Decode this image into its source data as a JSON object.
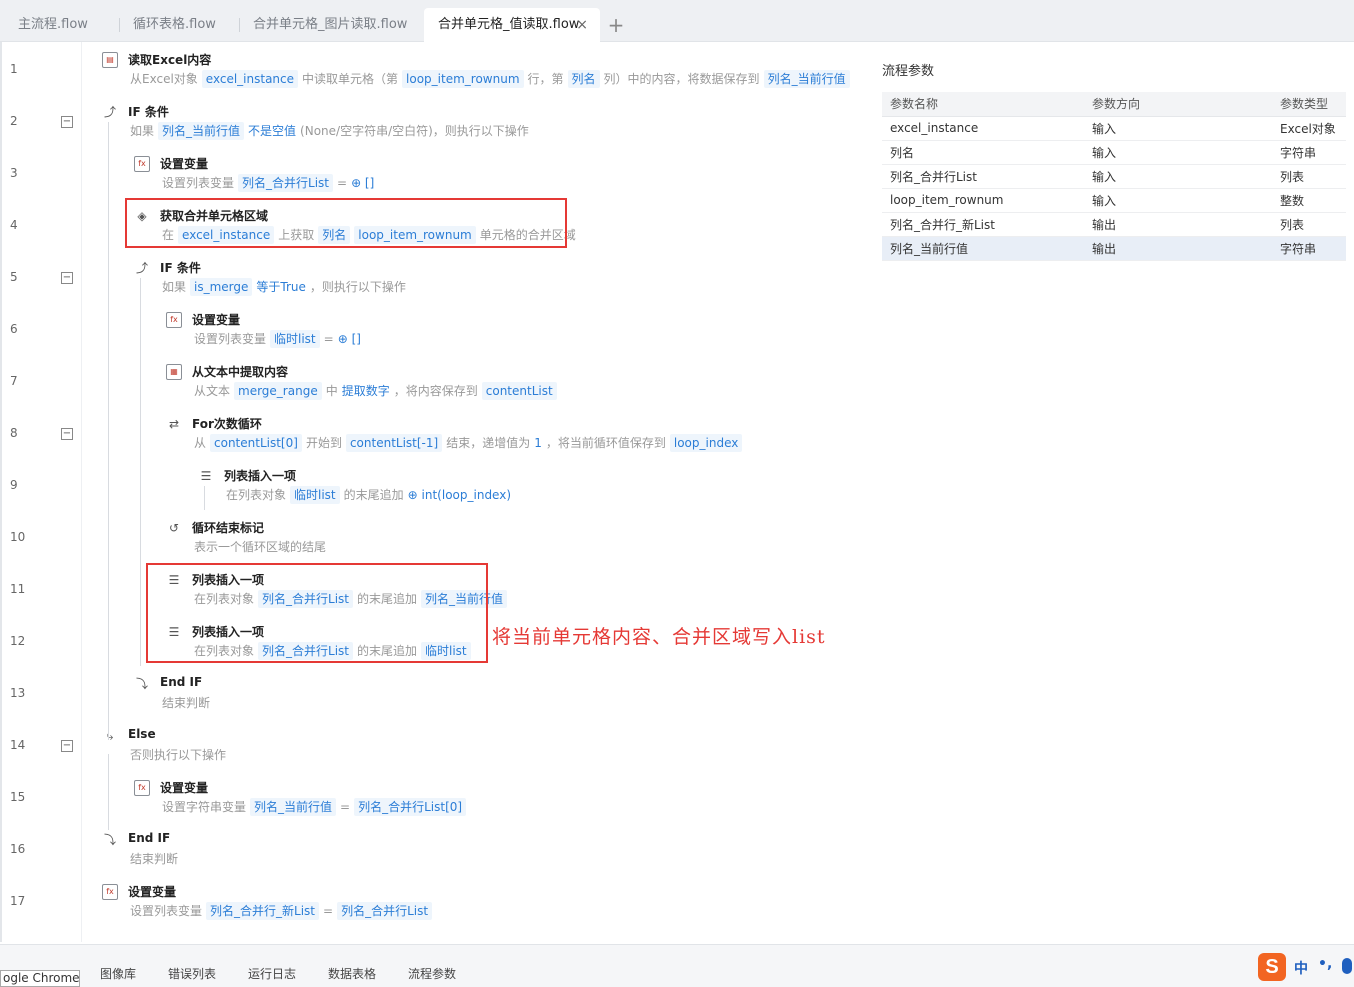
{
  "tabs": [
    {
      "label": "主流程.flow"
    },
    {
      "label": "循环表格.flow"
    },
    {
      "label": "合并单元格_图片读取.flow"
    },
    {
      "label": "合并单元格_值读取.flow"
    }
  ],
  "tabs_close": "×",
  "tabs_add": "+",
  "lines": [
    "1",
    "2",
    "3",
    "4",
    "5",
    "6",
    "7",
    "8",
    "9",
    "10",
    "11",
    "12",
    "13",
    "14",
    "15",
    "16",
    "17"
  ],
  "fold_symbol": "−",
  "steps": [
    {
      "icon": "excel-read-icon",
      "title": "读取Excel内容",
      "desc": [
        {
          "t": "从Excel对象"
        },
        {
          "t": "excel_instance",
          "k": "tk"
        },
        {
          "t": "中读取单元格（第"
        },
        {
          "t": "loop_item_rownum",
          "k": "tk"
        },
        {
          "t": "行，第"
        },
        {
          "t": "列名",
          "k": "tk"
        },
        {
          "t": "列）中的内容，将数据保存到"
        },
        {
          "t": "列名_当前行值",
          "k": "tk"
        }
      ]
    },
    {
      "icon": "if-icon",
      "title": "IF 条件",
      "desc": [
        {
          "t": "如果"
        },
        {
          "t": "列名_当前行值",
          "k": "tk"
        },
        {
          "t": "不是空值",
          "k": "bl"
        },
        {
          "t": "(None/空字符串/空白符)，则执行以下操作"
        }
      ]
    },
    {
      "icon": "set-variable-icon",
      "title": "设置变量",
      "desc": [
        {
          "t": "设置列表变量"
        },
        {
          "t": "列名_合并行List",
          "k": "tk"
        },
        {
          "t": "="
        },
        {
          "t": "⊕ []",
          "k": "bl"
        }
      ]
    },
    {
      "icon": "layers-icon",
      "title": "获取合并单元格区域",
      "desc": [
        {
          "t": "在"
        },
        {
          "t": "excel_instance",
          "k": "tk"
        },
        {
          "t": "上获取"
        },
        {
          "t": "列名",
          "k": "tk"
        },
        {
          "t": "loop_item_rownum",
          "k": "tk"
        },
        {
          "t": "单元格的合并区域"
        }
      ]
    },
    {
      "icon": "if-icon",
      "title": "IF 条件",
      "desc": [
        {
          "t": "如果"
        },
        {
          "t": "is_merge",
          "k": "tk"
        },
        {
          "t": "等于True",
          "k": "bl"
        },
        {
          "t": "，则执行以下操作"
        }
      ]
    },
    {
      "icon": "set-variable-icon",
      "title": "设置变量",
      "desc": [
        {
          "t": "设置列表变量"
        },
        {
          "t": "临时list",
          "k": "tk"
        },
        {
          "t": "="
        },
        {
          "t": "⊕ []",
          "k": "bl"
        }
      ]
    },
    {
      "icon": "text-extract-icon",
      "title": "从文本中提取内容",
      "desc": [
        {
          "t": "从文本"
        },
        {
          "t": "merge_range",
          "k": "tk"
        },
        {
          "t": "中"
        },
        {
          "t": "提取数字",
          "k": "bl"
        },
        {
          "t": "，将内容保存到"
        },
        {
          "t": "contentList",
          "k": "tk"
        }
      ]
    },
    {
      "icon": "loop-icon",
      "title": "For次数循环",
      "desc": [
        {
          "t": "从"
        },
        {
          "t": "contentList[0]",
          "k": "tk"
        },
        {
          "t": "开始到"
        },
        {
          "t": "contentList[-1]",
          "k": "tk"
        },
        {
          "t": "结束，递增值为"
        },
        {
          "t": "1",
          "k": "bl"
        },
        {
          "t": "，将当前循环值保存到"
        },
        {
          "t": "loop_index",
          "k": "tk"
        }
      ]
    },
    {
      "icon": "list-insert-icon",
      "title": "列表插入一项",
      "desc": [
        {
          "t": "在列表对象"
        },
        {
          "t": "临时list",
          "k": "tk"
        },
        {
          "t": "的末尾追加"
        },
        {
          "t": "⊕ int(loop_index)",
          "k": "bl"
        }
      ]
    },
    {
      "icon": "loop-end-icon",
      "title": "循环结束标记",
      "desc": [
        {
          "t": "表示一个循环区域的结尾"
        }
      ]
    },
    {
      "icon": "list-insert-icon",
      "title": "列表插入一项",
      "desc": [
        {
          "t": "在列表对象"
        },
        {
          "t": "列名_合并行List",
          "k": "tk"
        },
        {
          "t": "的末尾追加"
        },
        {
          "t": "列名_当前行值",
          "k": "tk"
        }
      ]
    },
    {
      "icon": "list-insert-icon",
      "title": "列表插入一项",
      "desc": [
        {
          "t": "在列表对象"
        },
        {
          "t": "列名_合并行List",
          "k": "tk"
        },
        {
          "t": "的末尾追加"
        },
        {
          "t": "临时list",
          "k": "tk"
        }
      ]
    },
    {
      "icon": "end-if-icon",
      "title": "End IF",
      "desc": [
        {
          "t": "结束判断"
        }
      ]
    },
    {
      "icon": "else-icon",
      "title": "Else",
      "desc": [
        {
          "t": "否则执行以下操作"
        }
      ]
    },
    {
      "icon": "set-variable-icon",
      "title": "设置变量",
      "desc": [
        {
          "t": "设置字符串变量"
        },
        {
          "t": "列名_当前行值",
          "k": "tk"
        },
        {
          "t": "="
        },
        {
          "t": "列名_合并行List[0]",
          "k": "tk"
        }
      ]
    },
    {
      "icon": "end-if-icon",
      "title": "End IF",
      "desc": [
        {
          "t": "结束判断"
        }
      ]
    },
    {
      "icon": "set-variable-icon",
      "title": "设置变量",
      "desc": [
        {
          "t": "设置列表变量"
        },
        {
          "t": "列名_合并行_新List",
          "k": "tk"
        },
        {
          "t": "="
        },
        {
          "t": "列名_合并行List",
          "k": "tk"
        }
      ]
    }
  ],
  "annotation": "将当前单元格内容、合并区域写入list",
  "params": {
    "title": "流程参数",
    "headers": [
      "参数名称",
      "参数方向",
      "参数类型"
    ],
    "rows": [
      [
        "excel_instance",
        "输入",
        "Excel对象"
      ],
      [
        "列名",
        "输入",
        "字符串"
      ],
      [
        "列名_合并行List",
        "输入",
        "列表"
      ],
      [
        "loop_item_rownum",
        "输入",
        "整数"
      ],
      [
        "列名_合并行_新List",
        "输出",
        "列表"
      ],
      [
        "列名_当前行值",
        "输出",
        "字符串"
      ]
    ],
    "selected_row": 5
  },
  "bottom_tabs": [
    "图像库",
    "错误列表",
    "运行日志",
    "数据表格",
    "流程参数"
  ],
  "taskbar_hint": "ogle Chrome",
  "ime": {
    "logo": "S",
    "mode": "中",
    "punct": "•,"
  }
}
